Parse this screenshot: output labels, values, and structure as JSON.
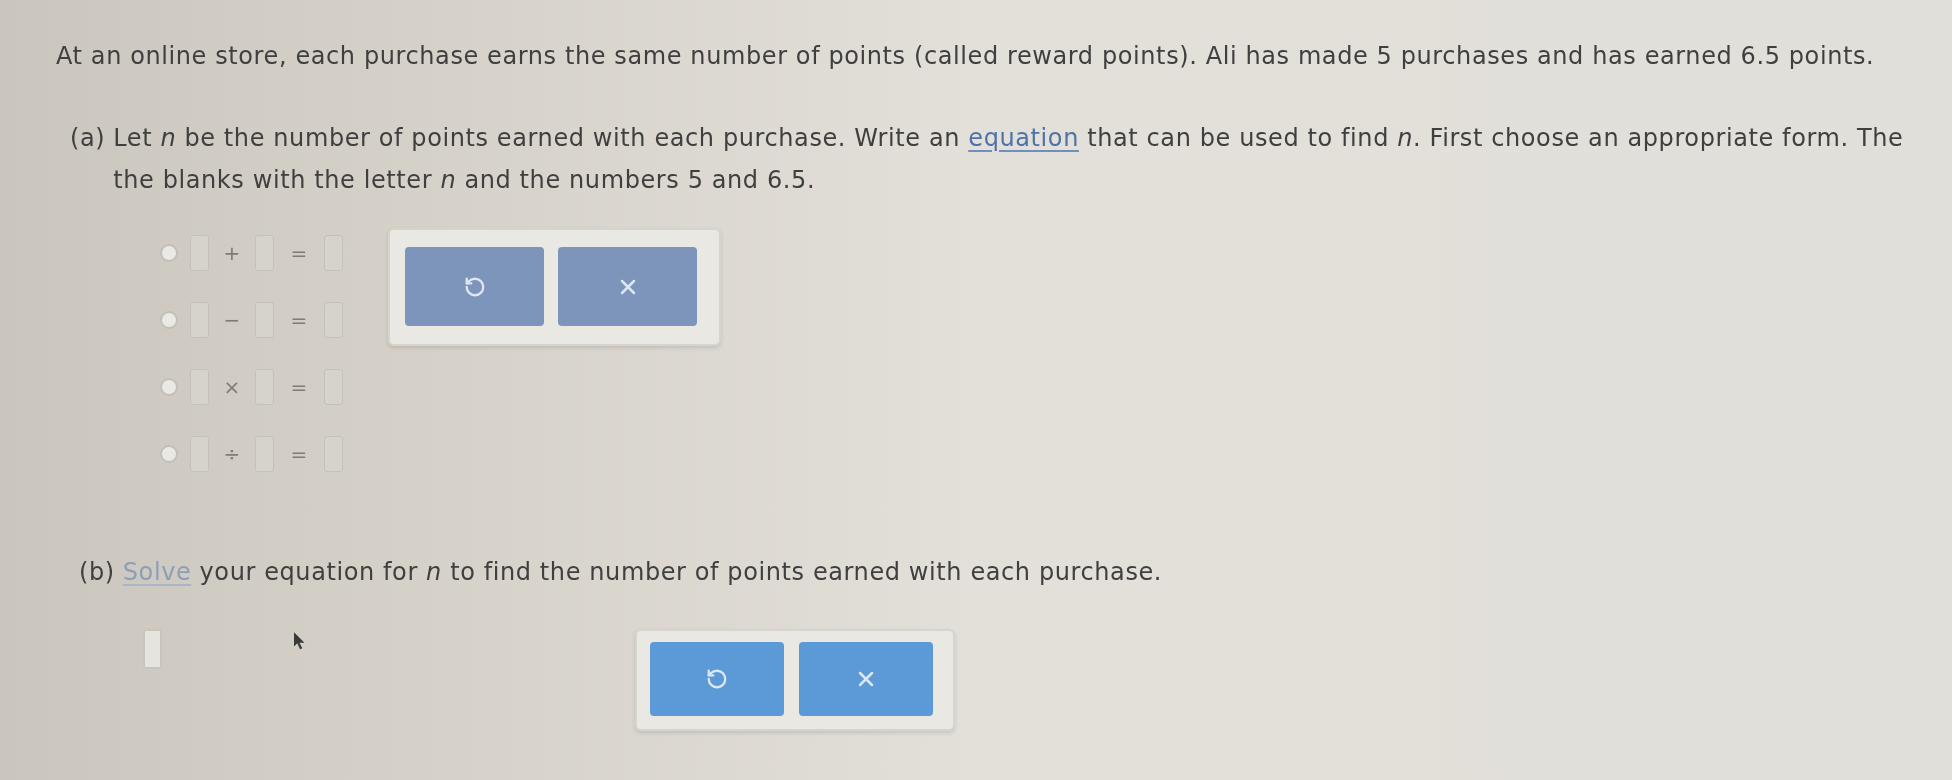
{
  "problem": {
    "text": "At an online store, each purchase earns the same number of points (called reward points). Ali has made 5 purchases and has earned 6.5 points."
  },
  "part_a": {
    "label": "(a)",
    "prompt": [
      {
        "kind": "text",
        "text": "Let *n* be the number of points earned with each purchase. Write an "
      },
      {
        "kind": "link",
        "text": "equation"
      },
      {
        "kind": "text",
        "text": " that can be used to find *n*. First choose an appropriate form. The"
      },
      {
        "kind": "break"
      },
      {
        "kind": "text",
        "text": "the blanks with the letter *n* and the numbers 5 and 6.5."
      }
    ],
    "options": [
      {
        "selected": false,
        "operator": "+",
        "equals": "="
      },
      {
        "selected": false,
        "operator": "−",
        "equals": "="
      },
      {
        "selected": false,
        "operator": "×",
        "equals": "="
      },
      {
        "selected": false,
        "operator": "÷",
        "equals": "="
      }
    ]
  },
  "part_b": {
    "label": "(b)",
    "prompt": [
      {
        "kind": "link",
        "text": "Solve"
      },
      {
        "kind": "text",
        "text": " your equation for *n* to find the number of points earned with each purchase."
      }
    ]
  }
}
